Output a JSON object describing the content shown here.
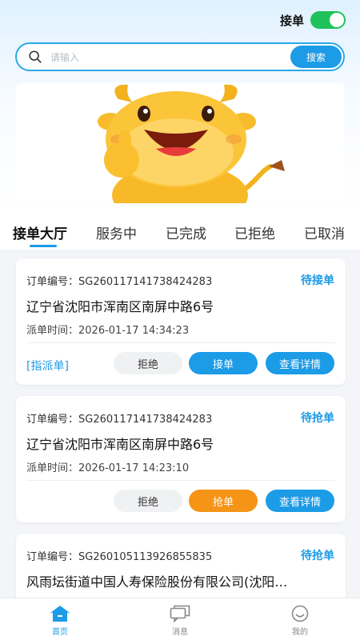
{
  "header": {
    "toggle_label": "接单",
    "toggle_on": true
  },
  "search": {
    "placeholder": "请输入",
    "button_label": "搜索"
  },
  "tabs": [
    {
      "label": "接单大厅",
      "active": true
    },
    {
      "label": "服务中",
      "active": false
    },
    {
      "label": "已完成",
      "active": false
    },
    {
      "label": "已拒绝",
      "active": false
    },
    {
      "label": "已取消",
      "active": false
    }
  ],
  "orders": [
    {
      "order_label": "订单编号：",
      "order_no": "SG260117141738424283",
      "status": "待接单",
      "address": "辽宁省沈阳市浑南区南屏中路6号",
      "time_label": "派单时间：",
      "time": "2026-01-17 14:34:23",
      "tag": "[指派单]",
      "reject_label": "拒绝",
      "action_label": "接单",
      "detail_label": "查看详情"
    },
    {
      "order_label": "订单编号：",
      "order_no": "SG260117141738424283",
      "status": "待抢单",
      "address": "辽宁省沈阳市浑南区南屏中路6号",
      "time_label": "派单时间：",
      "time": "2026-01-17 14:23:10",
      "reject_label": "拒绝",
      "action_label": "抢单",
      "detail_label": "查看详情"
    },
    {
      "order_label": "订单编号：",
      "order_no": "SG260105113926855835",
      "status": "待抢单",
      "address": "风雨坛街道中国人寿保险股份有限公司(沈阳…"
    }
  ],
  "bottom_nav": [
    {
      "label": "首页",
      "icon": "home-icon",
      "active": true
    },
    {
      "label": "消息",
      "icon": "message-icon",
      "active": false
    },
    {
      "label": "我的",
      "icon": "profile-icon",
      "active": false
    }
  ],
  "colors": {
    "accent": "#1c9be7",
    "toggle_on": "#1fc25a",
    "grab_button": "#f59416"
  }
}
